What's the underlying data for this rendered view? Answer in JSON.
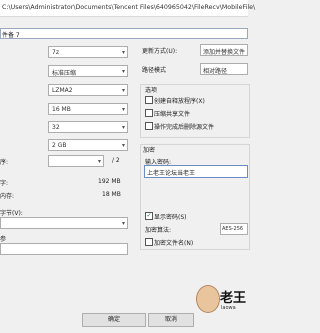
{
  "title_bar": {
    "path": "C:\\Users\\Administrator\\Documents\\Tencent Files\\640965042\\FileRecv\\MobileFile\\"
  },
  "archive": {
    "name_label": "件备 7"
  },
  "left": {
    "format_value": "7z",
    "level_value": "标准压缩",
    "method_value": "LZMA2",
    "dict_value": "16 MB",
    "word_value": "32",
    "solid_value": "2 GB",
    "threads_label": "序:",
    "threads_max": "/ 2",
    "mem_compress_label": "字:",
    "mem_compress_value": "192 MB",
    "mem_decompress_label": "内存:",
    "mem_decompress_value": "18 MB",
    "split_label": "字节(V):",
    "params_label": "参"
  },
  "right": {
    "update_mode_label": "更新方式(U):",
    "update_mode_value": "添加并替换文件",
    "path_mode_label": "路径模式",
    "path_mode_value": "相对路径",
    "options_title": "选项",
    "opt_sfx": "创建自释放程序(X)",
    "opt_shared": "压缩共享文件",
    "opt_delete": "操作完成后删除源文件",
    "encryption_title": "加密",
    "password_label": "输入密码:",
    "password_value": "上老王论坛当老王",
    "show_password": "显示密码(S)",
    "enc_method_label": "加密算法:",
    "enc_method_value": "AES-256",
    "enc_names": "加密文件名(N)"
  },
  "buttons": {
    "ok": "确定",
    "cancel": "取消"
  },
  "watermark": {
    "text": "老王",
    "sub": "laowa"
  }
}
